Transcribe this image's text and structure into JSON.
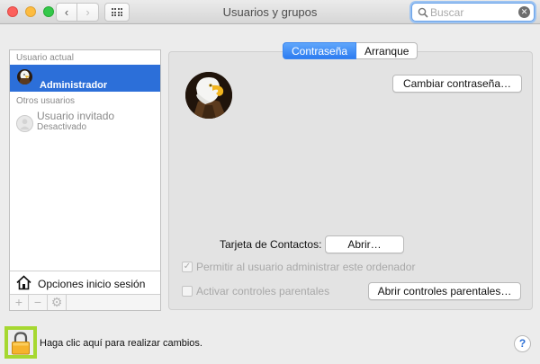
{
  "window": {
    "title": "Usuarios y grupos",
    "back_icon": "‹",
    "forward_icon": "›",
    "search_placeholder": "Buscar"
  },
  "sidebar": {
    "current_user_header": "Usuario actual",
    "current_user_name": "Administrador",
    "other_users_header": "Otros usuarios",
    "guest_name": "Usuario invitado",
    "guest_status": "Desactivado",
    "login_options_label": "Opciones inicio sesión",
    "toolbar": {
      "add": "+",
      "remove": "−",
      "gear": "⚙"
    }
  },
  "tabs": [
    {
      "label": "Contraseña",
      "active": true
    },
    {
      "label": "Arranque",
      "active": false
    }
  ],
  "main": {
    "change_password_button": "Cambiar contraseña…",
    "contact_card_label": "Tarjeta de Contactos:",
    "open_button": "Abrir…",
    "allow_admin_label": "Permitir al usuario administrar este ordenador",
    "allow_admin_checked": true,
    "parental_controls_label": "Activar controles parentales",
    "parental_controls_checked": false,
    "open_parental_button": "Abrir controles parentales…"
  },
  "footer": {
    "lock_text": "Haga clic aquí para realizar cambios.",
    "help_label": "?"
  },
  "colors": {
    "accent": "#2c6fd9",
    "highlight": "#a6d831"
  }
}
